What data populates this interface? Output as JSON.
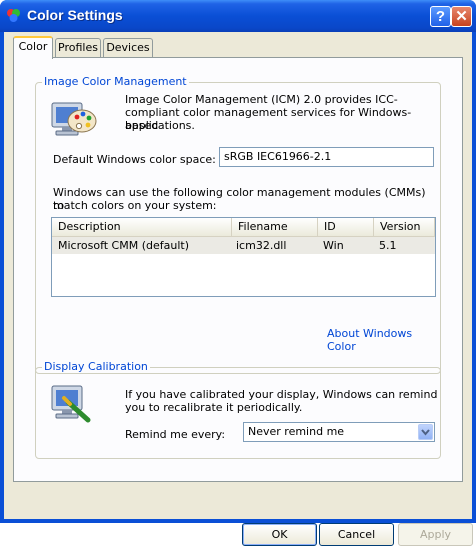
{
  "window": {
    "title": "Color Settings",
    "help_glyph": "?",
    "close_glyph": "✕"
  },
  "tabs": [
    {
      "label": "Color",
      "active": true
    },
    {
      "label": "Profiles",
      "active": false
    },
    {
      "label": "Devices",
      "active": false
    }
  ],
  "icm_group": {
    "legend": "Image Color Management",
    "description_lines": [
      "Image Color Management (ICM) 2.0 provides ICC-",
      "compliant color management services for Windows-based",
      "applications."
    ],
    "color_space_label": "Default Windows color space:",
    "color_space_value": "sRGB IEC61966-2.1",
    "cmm_intro_lines": [
      "Windows can use the following color management modules (CMMs) to",
      "match colors on your system:"
    ],
    "table": {
      "headers": [
        "Description",
        "Filename",
        "ID",
        "Version"
      ],
      "rows": [
        [
          "Microsoft CMM (default)",
          "icm32.dll",
          "Win",
          "5.1"
        ]
      ]
    },
    "about_link": "About Windows Color"
  },
  "calibration_group": {
    "legend": "Display Calibration",
    "description_lines": [
      "If you have calibrated your display, Windows can remind",
      "you to recalibrate it periodically."
    ],
    "remind_label": "Remind me every:",
    "remind_value": "Never remind me"
  },
  "buttons": {
    "ok": "OK",
    "cancel": "Cancel",
    "apply": "Apply"
  },
  "colors": {
    "titlebar": "#0a4fd6",
    "link": "#0046d5",
    "dialog_bg": "#ece9d8"
  }
}
